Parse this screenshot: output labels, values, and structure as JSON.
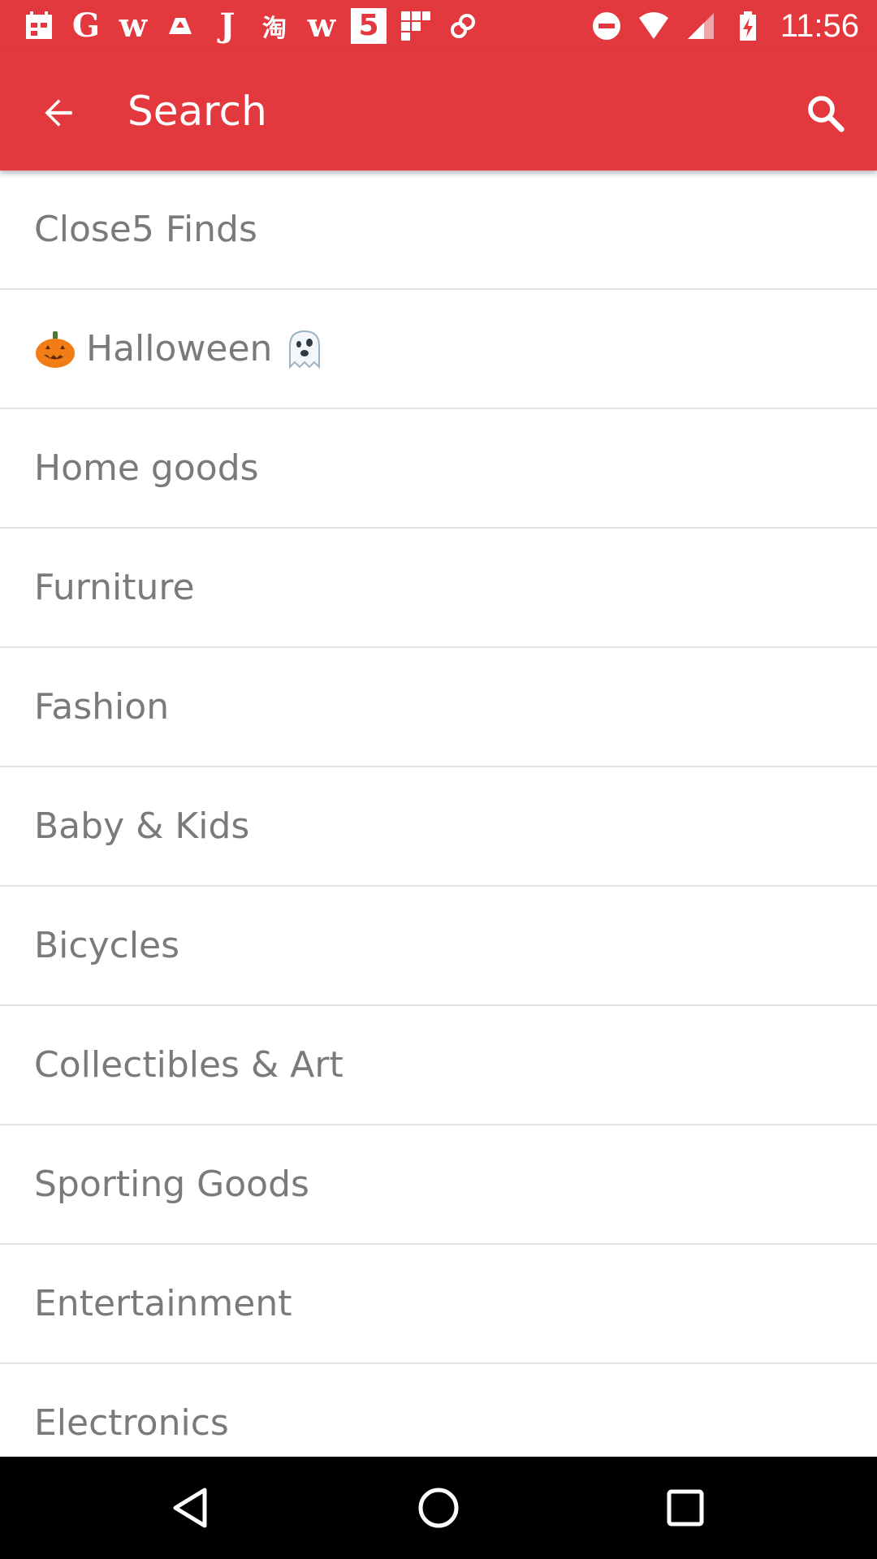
{
  "status_bar": {
    "time": "11:56",
    "notification_icons": [
      "calendar-icon",
      "google-icon",
      "w-app-icon",
      "drive-icon",
      "j-app-icon",
      "taobao-icon",
      "w-app-icon",
      "five-app-icon",
      "grid-app-icon",
      "link-icon"
    ],
    "system_icons": [
      "do-not-disturb-icon",
      "wifi-icon",
      "cell-signal-icon",
      "battery-charging-icon"
    ],
    "letters": {
      "g": "G",
      "w": "w",
      "j": "J",
      "taobao": "淘",
      "w2": "w",
      "five": "5"
    }
  },
  "app_bar": {
    "search_placeholder": "Search",
    "background_color": "#e3393e"
  },
  "categories": [
    {
      "label": "Close5 Finds"
    },
    {
      "label": "Halloween",
      "emoji_before": "pumpkin",
      "emoji_after": "ghost"
    },
    {
      "label": "Home goods"
    },
    {
      "label": "Furniture"
    },
    {
      "label": "Fashion"
    },
    {
      "label": "Baby & Kids"
    },
    {
      "label": "Bicycles"
    },
    {
      "label": "Collectibles & Art"
    },
    {
      "label": "Sporting Goods"
    },
    {
      "label": "Entertainment"
    },
    {
      "label": "Electronics"
    }
  ],
  "nav_bar": {
    "buttons": [
      "back-triangle-icon",
      "home-circle-icon",
      "recents-square-icon"
    ]
  }
}
